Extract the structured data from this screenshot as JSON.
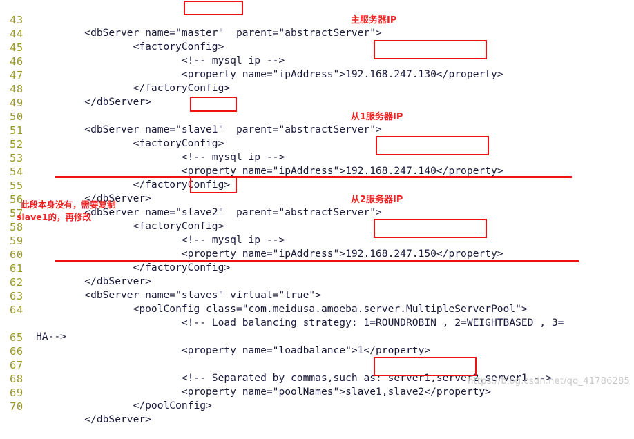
{
  "editor": {
    "language": "xml",
    "first_line_number": 43,
    "gutter_color": "#9a9a25",
    "code_color": "#1a1a3d",
    "annotation_color": "#ee1111",
    "background": "#ffffff"
  },
  "lines": [
    {
      "num": "43",
      "text": "        <dbServer name=\"master\"  parent=\"abstractServer\">"
    },
    {
      "num": "44",
      "text": "                <factoryConfig>"
    },
    {
      "num": "45",
      "text": "                        <!-- mysql ip -->"
    },
    {
      "num": "46",
      "text": "                        <property name=\"ipAddress\">192.168.247.130</property>"
    },
    {
      "num": "47",
      "text": "                </factoryConfig>"
    },
    {
      "num": "48",
      "text": "        </dbServer>"
    },
    {
      "num": "49",
      "text": ""
    },
    {
      "num": "50",
      "text": "        <dbServer name=\"slave1\"  parent=\"abstractServer\">"
    },
    {
      "num": "51",
      "text": "                <factoryConfig>"
    },
    {
      "num": "52",
      "text": "                        <!-- mysql ip -->"
    },
    {
      "num": "53",
      "text": "                        <property name=\"ipAddress\">192.168.247.140</property>"
    },
    {
      "num": "54",
      "text": "                </factoryConfig>"
    },
    {
      "num": "55",
      "text": "        </dbServer>"
    },
    {
      "num": "56",
      "text": "        <dbServer name=\"slave2\"  parent=\"abstractServer\">"
    },
    {
      "num": "57",
      "text": "                <factoryConfig>"
    },
    {
      "num": "58",
      "text": "                        <!-- mysql ip -->"
    },
    {
      "num": "59",
      "text": "                        <property name=\"ipAddress\">192.168.247.150</property>"
    },
    {
      "num": "60",
      "text": "                </factoryConfig>"
    },
    {
      "num": "61",
      "text": "        </dbServer>"
    },
    {
      "num": "62",
      "text": "        <dbServer name=\"slaves\" virtual=\"true\">"
    },
    {
      "num": "63",
      "text": "                <poolConfig class=\"com.meidusa.amoeba.server.MultipleServerPool\">"
    },
    {
      "num": "64",
      "text": "                        <!-- Load balancing strategy: 1=ROUNDROBIN , 2=WEIGHTBASED , 3="
    },
    {
      "num": "",
      "text": "HA-->"
    },
    {
      "num": "65",
      "text": "                        <property name=\"loadbalance\">1</property>"
    },
    {
      "num": "66",
      "text": ""
    },
    {
      "num": "67",
      "text": "                        <!-- Separated by commas,such as: server1,server2,server1 -->"
    },
    {
      "num": "68",
      "text": "                        <property name=\"poolNames\">slave1,slave2</property>"
    },
    {
      "num": "69",
      "text": "                </poolConfig>"
    },
    {
      "num": "70",
      "text": "        </dbServer>"
    }
  ],
  "annotations": {
    "notes": [
      {
        "id": "master-ip-note",
        "text": "主服务器IP"
      },
      {
        "id": "slave1-ip-note",
        "text": "从1服务器IP"
      },
      {
        "id": "slave2-ip-note",
        "text": "从2服务器IP"
      },
      {
        "id": "copy-hint-line1",
        "text": "此段本身没有，需要复制"
      },
      {
        "id": "copy-hint-line2",
        "text": "slave1的，再修改"
      }
    ],
    "highlight_boxes": [
      {
        "id": "master-name-box",
        "value": "\"master\""
      },
      {
        "id": "master-ip-box",
        "value": "192.168.247.130"
      },
      {
        "id": "slave1-name-box",
        "value": "slave1"
      },
      {
        "id": "slave1-ip-box",
        "value": "192.168.247.140"
      },
      {
        "id": "slave2-name-box",
        "value": "slave2"
      },
      {
        "id": "slave2-ip-box",
        "value": "192.168.247.150"
      },
      {
        "id": "poolnames-box",
        "value": "slave1,slave2"
      }
    ],
    "rules": [
      {
        "id": "copy-block-top-rule"
      },
      {
        "id": "copy-block-bottom-rule"
      }
    ]
  },
  "watermark": {
    "text": "https://blog.csdn.net/qq_41786285"
  }
}
